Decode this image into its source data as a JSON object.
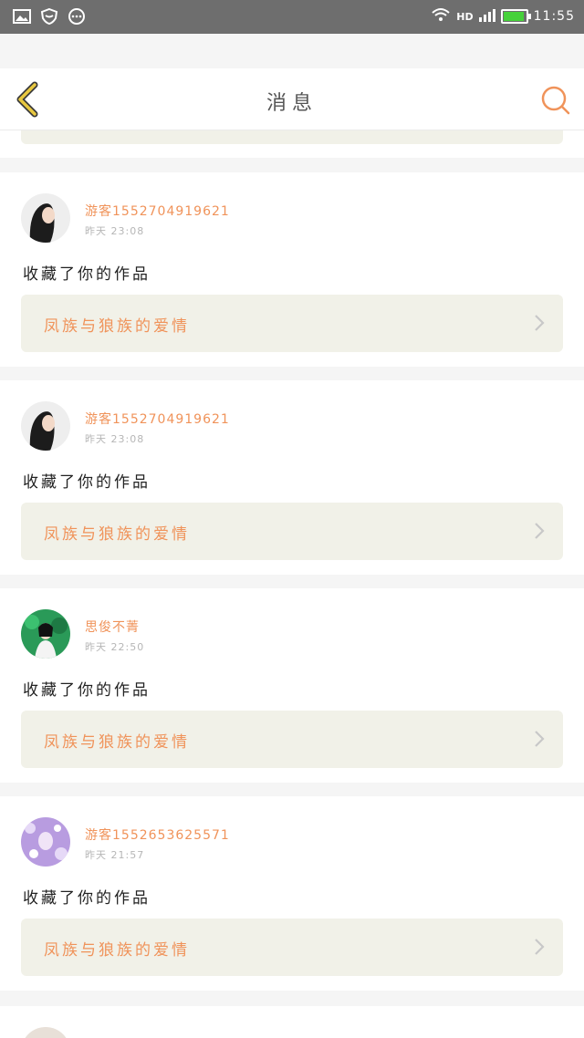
{
  "status_bar": {
    "time": "11:55",
    "network": "HD",
    "battery_level": 0.85
  },
  "header": {
    "title": "消息",
    "back_icon": "back-chevron-icon",
    "search_icon": "search-icon"
  },
  "messages": [
    {
      "username": "游客1552704919621",
      "time": "昨天 23:08",
      "action": "收藏了你的作品",
      "work_title": "凤族与狼族的爱情"
    },
    {
      "username": "游客1552704919621",
      "time": "昨天 23:08",
      "action": "收藏了你的作品",
      "work_title": "凤族与狼族的爱情"
    },
    {
      "username": "思俊不菁",
      "time": "昨天 22:50",
      "action": "收藏了你的作品",
      "work_title": "凤族与狼族的爱情"
    },
    {
      "username": "游客1552653625571",
      "time": "昨天 21:57",
      "action": "收藏了你的作品",
      "work_title": "凤族与狼族的爱情"
    }
  ],
  "colors": {
    "accent": "#f0935a",
    "back": "#e8c840",
    "card_box": "#f1f1e8"
  }
}
